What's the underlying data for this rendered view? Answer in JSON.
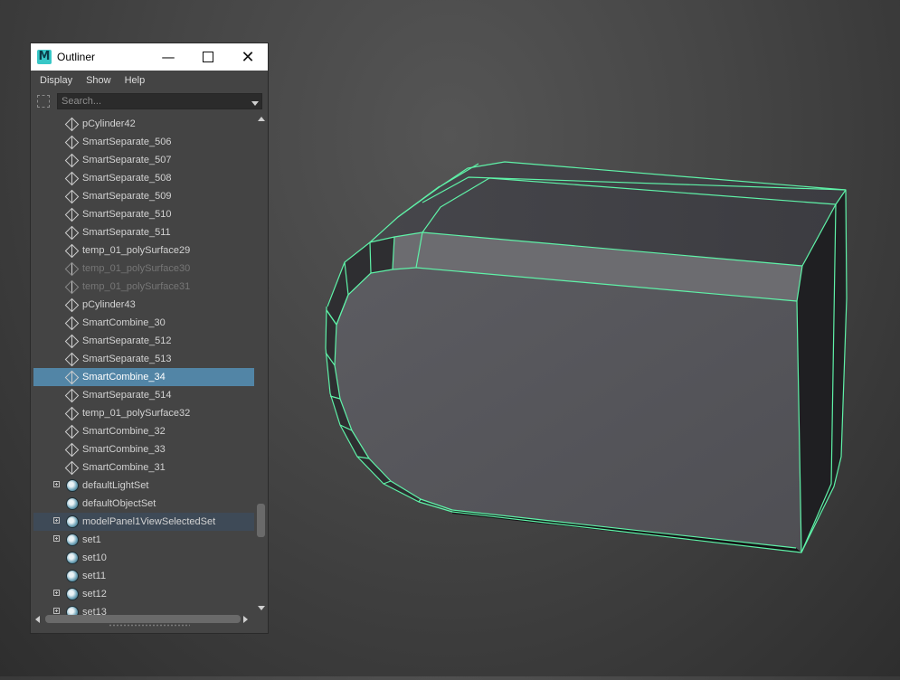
{
  "window": {
    "app_icon_letter": "M",
    "title": "Outliner",
    "minimize_glyph": "—",
    "close_glyph": "✕"
  },
  "menu": [
    "Display",
    "Show",
    "Help"
  ],
  "search": {
    "placeholder": "Search...",
    "value": ""
  },
  "tree_items": [
    {
      "label": "pCylinder42",
      "icon": "mesh-icon"
    },
    {
      "label": "SmartSeparate_506",
      "icon": "mesh-icon"
    },
    {
      "label": "SmartSeparate_507",
      "icon": "mesh-icon"
    },
    {
      "label": "SmartSeparate_508",
      "icon": "mesh-icon"
    },
    {
      "label": "SmartSeparate_509",
      "icon": "mesh-icon"
    },
    {
      "label": "SmartSeparate_510",
      "icon": "mesh-icon"
    },
    {
      "label": "SmartSeparate_511",
      "icon": "mesh-icon"
    },
    {
      "label": "temp_01_polySurface29",
      "icon": "mesh-icon"
    },
    {
      "label": "temp_01_polySurface30",
      "icon": "mesh-icon",
      "state": "hidden"
    },
    {
      "label": "temp_01_polySurface31",
      "icon": "mesh-icon",
      "state": "hidden"
    },
    {
      "label": "pCylinder43",
      "icon": "mesh-icon"
    },
    {
      "label": "SmartCombine_30",
      "icon": "mesh-icon"
    },
    {
      "label": "SmartSeparate_512",
      "icon": "mesh-icon"
    },
    {
      "label": "SmartSeparate_513",
      "icon": "mesh-icon"
    },
    {
      "label": "SmartCombine_34",
      "icon": "mesh-icon",
      "state": "selected"
    },
    {
      "label": "SmartSeparate_514",
      "icon": "mesh-icon"
    },
    {
      "label": "temp_01_polySurface32",
      "icon": "mesh-icon"
    },
    {
      "label": "SmartCombine_32",
      "icon": "mesh-icon"
    },
    {
      "label": "SmartCombine_33",
      "icon": "mesh-icon"
    },
    {
      "label": "SmartCombine_31",
      "icon": "mesh-icon"
    },
    {
      "label": "defaultLightSet",
      "icon": "set-icon",
      "expandable": true
    },
    {
      "label": "defaultObjectSet",
      "icon": "set-icon"
    },
    {
      "label": "modelPanel1ViewSelectedSet",
      "icon": "set-icon",
      "expandable": true,
      "state": "highlight"
    },
    {
      "label": "set1",
      "icon": "set-icon",
      "expandable": true
    },
    {
      "label": "set10",
      "icon": "set-icon"
    },
    {
      "label": "set11",
      "icon": "set-icon"
    },
    {
      "label": "set12",
      "icon": "set-icon",
      "expandable": true
    },
    {
      "label": "set13",
      "icon": "set-icon",
      "expandable": true
    }
  ],
  "colors": {
    "wireframe_highlight": "#5ff2a8",
    "selection_row": "#5285a6",
    "highlight_row": "#3e4a57"
  }
}
